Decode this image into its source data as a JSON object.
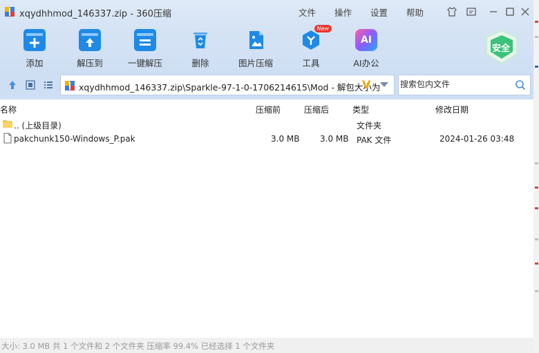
{
  "window": {
    "title": "xqydhhmod_146337.zip - 360压缩"
  },
  "menu": {
    "file": "文件",
    "actions": "操作",
    "settings": "设置",
    "help": "帮助"
  },
  "toolbar": {
    "add": "添加",
    "extract_to": "解压到",
    "one_click_extract": "一键解压",
    "delete": "删除",
    "image_compress": "图片压缩",
    "tools": "工具",
    "tools_badge": "New",
    "ai_office": "AI办公",
    "ai_glyph": "AI",
    "safe_label": "安全"
  },
  "address": {
    "path": "xqydhhmod_146337.zip\\Sparkle-97-1-0-1706214615\\Mod - 解包大小为",
    "v_mark": "V"
  },
  "search": {
    "placeholder": "搜索包内文件"
  },
  "columns": {
    "name": "名称",
    "packed_size": "压缩前",
    "size": "压缩后",
    "type": "类型",
    "modified": "修改日期"
  },
  "rows": [
    {
      "name": ".. (上级目录)",
      "packed": "",
      "size": "",
      "type": "文件夹",
      "modified": "",
      "icon": "folder-icon"
    },
    {
      "name": "pakchunk150-Windows_P.pak",
      "packed": "3.0 MB",
      "size": "3.0 MB",
      "type": "PAK 文件",
      "modified": "2024-01-26 03:48",
      "icon": "file-icon"
    }
  ],
  "status": {
    "text": "大小: 3.0 MB 共 1 个文件和 2 个文件夹 压缩率 99.4% 已经选择 1 个文件夹"
  },
  "colors": {
    "toolbar_bg": "#d6e4f5",
    "accent_blue": "#1e88e5",
    "safe_green": "#3cc27a",
    "new_badge": "#e8372e"
  }
}
